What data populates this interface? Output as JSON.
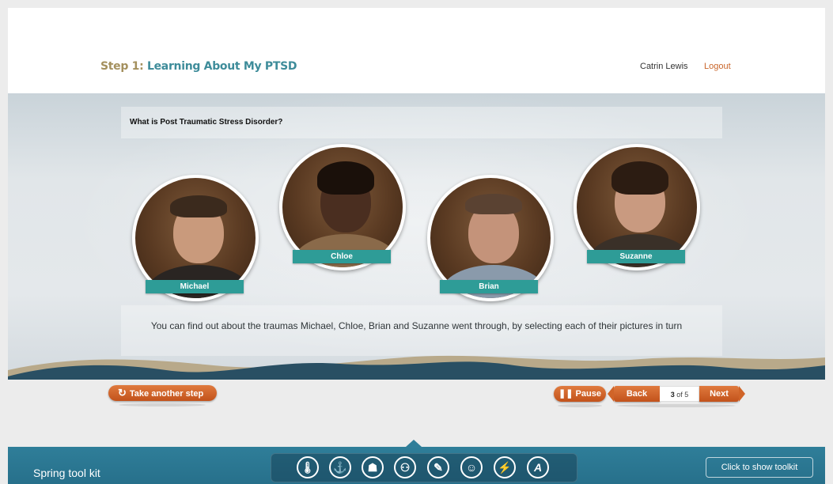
{
  "header": {
    "step_prefix": "Step 1:",
    "step_title": "Learning About My PTSD",
    "user_name": "Catrin Lewis",
    "logout_label": "Logout"
  },
  "content": {
    "question": "What is Post Traumatic Stress Disorder?",
    "caption": "You can find out about the traumas Michael, Chloe, Brian and Suzanne went through, by selecting each of their pictures in turn"
  },
  "people": [
    {
      "name": "Michael"
    },
    {
      "name": "Chloe"
    },
    {
      "name": "Brian"
    },
    {
      "name": "Suzanne"
    }
  ],
  "controls": {
    "take_another_step": "Take another step",
    "pause": "Pause",
    "back": "Back",
    "page_current": "3",
    "page_of": "of 5",
    "next": "Next"
  },
  "toolkit": {
    "title": "Spring tool kit",
    "show_label": "Click to show toolkit",
    "icons": [
      "thermometer-icon",
      "anchor-icon",
      "meditation-icon",
      "people-icon",
      "notepad-icon",
      "head-icon",
      "activity-icon",
      "font-a-icon"
    ]
  },
  "colors": {
    "accent_orange": "#c9652a",
    "teal_tag": "#2e9c97",
    "toolkit_blue": "#2f7e99",
    "step_gold": "#a4905e",
    "step_teal": "#3e8c9a"
  }
}
